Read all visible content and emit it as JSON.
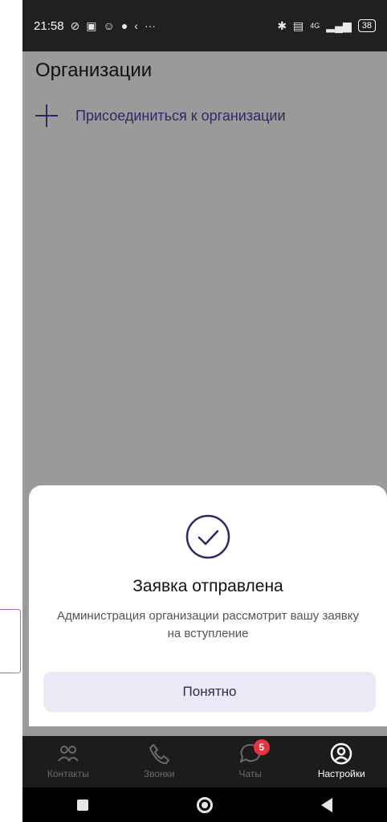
{
  "status_bar": {
    "time": "21:58",
    "left_icons": [
      "wifi-off-icon",
      "nfc-icon",
      "face-icon",
      "chat-bubble-icon",
      "feather-icon"
    ],
    "more": "···",
    "network": "4G",
    "battery": "38"
  },
  "page": {
    "title": "Организации",
    "join_label": "Присоединиться к организации"
  },
  "dialog": {
    "title": "Заявка отправлена",
    "message": "Администрация организации рассмотрит вашу заявку на вступление",
    "ok_label": "Понятно"
  },
  "bottom_nav": {
    "items": [
      {
        "label": "Контакты",
        "icon": "contacts-icon"
      },
      {
        "label": "Звонки",
        "icon": "phone-icon"
      },
      {
        "label": "Чаты",
        "icon": "chat-icon",
        "badge": "5"
      },
      {
        "label": "Настройки",
        "icon": "settings-icon",
        "active": true
      }
    ]
  },
  "colors": {
    "accent": "#2c2a63",
    "badge": "#e4343f",
    "overlay": "#9a9a9a"
  }
}
